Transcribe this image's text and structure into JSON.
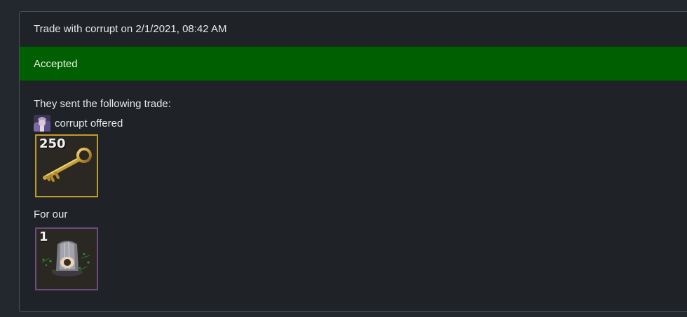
{
  "card": {
    "title": "Trade with corrupt on 2/1/2021, 08:42 AM",
    "status": "Accepted",
    "status_color": "#005f00"
  },
  "body": {
    "intro": "They sent the following trade:",
    "offer_line": "corrupt offered",
    "offered_item": {
      "count": "250",
      "icon": "key-icon",
      "quality_color": "#c09d2a"
    },
    "for_label": "For our",
    "requested_item": {
      "count": "1",
      "icon": "unusual-hat-icon",
      "quality_color": "#6c4b80"
    }
  }
}
